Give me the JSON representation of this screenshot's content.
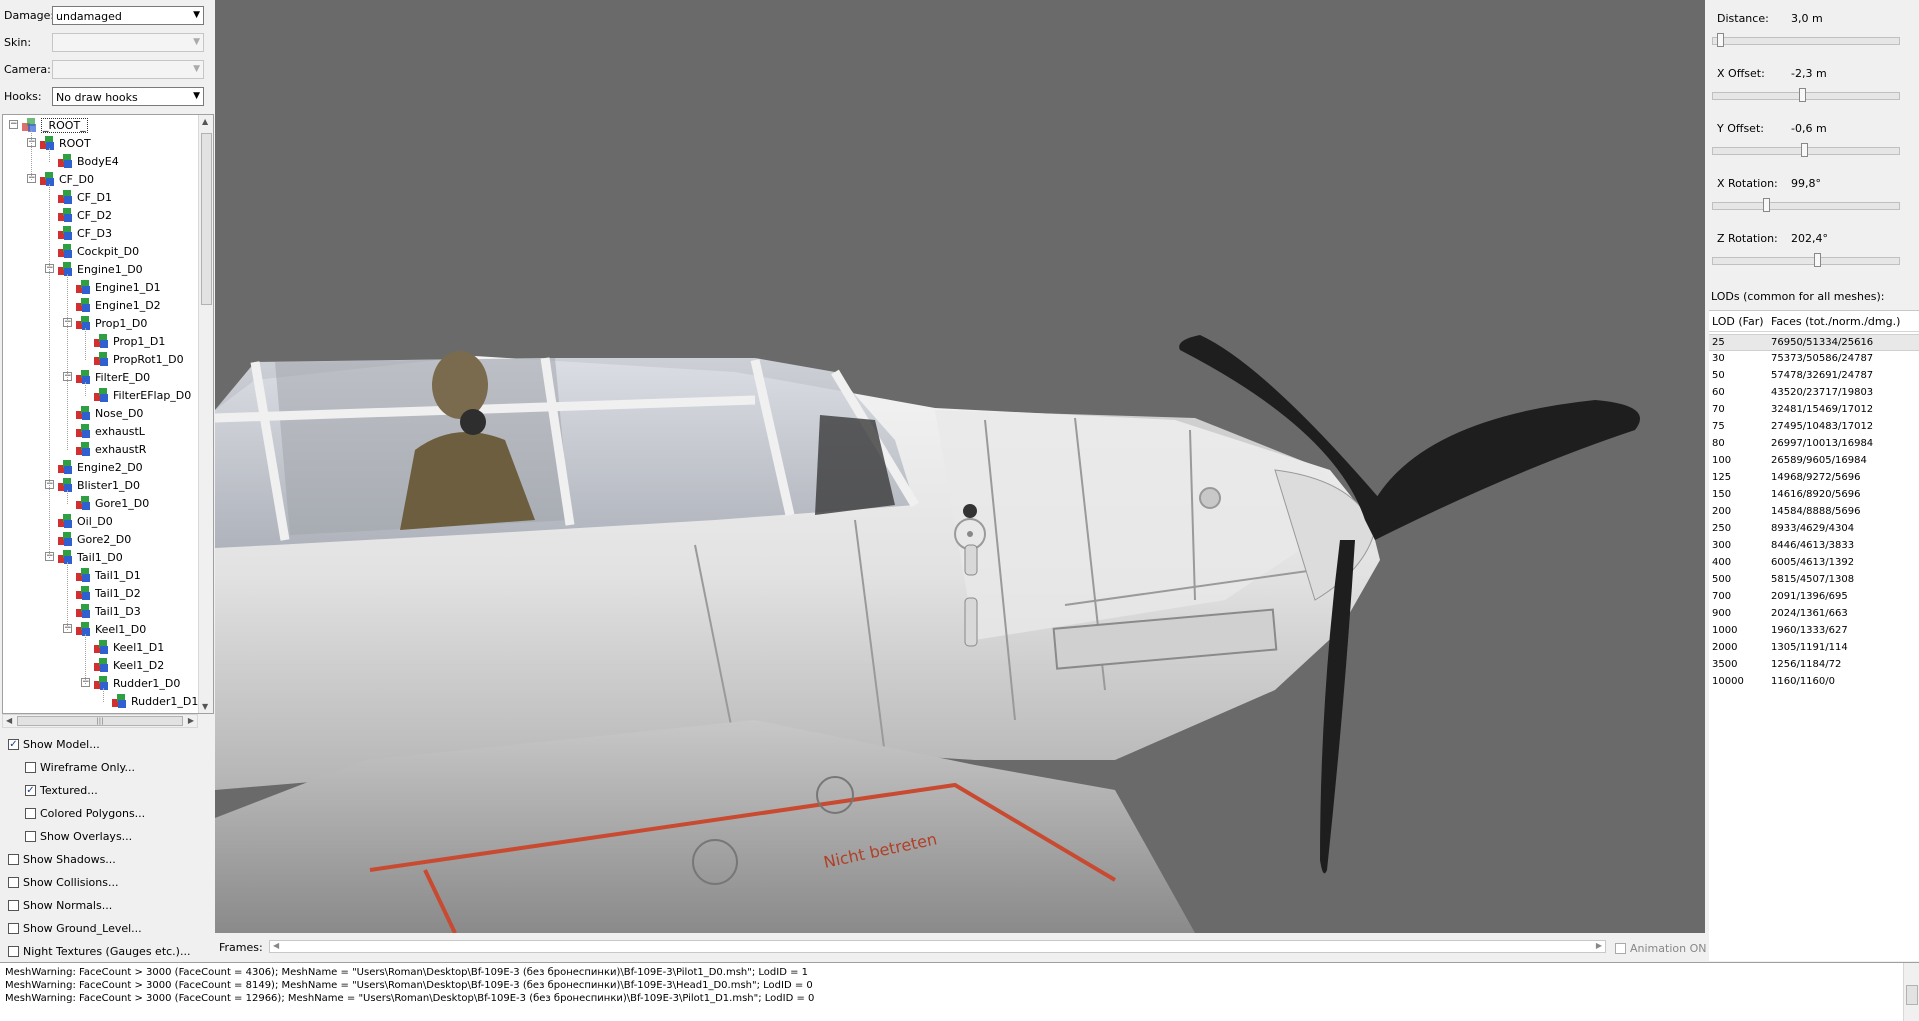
{
  "controls": {
    "damage": {
      "label": "Damage:",
      "value": "undamaged"
    },
    "skin": {
      "label": "Skin:",
      "value": ""
    },
    "camera": {
      "label": "Camera:",
      "value": ""
    },
    "hooks": {
      "label": "Hooks:",
      "value": "No draw hooks"
    }
  },
  "tree": {
    "nodes": [
      {
        "label": "_ROOT_",
        "depth": 0,
        "expandable": true,
        "root": true,
        "selected": true
      },
      {
        "label": "ROOT",
        "depth": 1,
        "expandable": true
      },
      {
        "label": "BodyE4",
        "depth": 2,
        "expandable": false
      },
      {
        "label": "CF_D0",
        "depth": 1,
        "expandable": true
      },
      {
        "label": "CF_D1",
        "depth": 2,
        "expandable": false
      },
      {
        "label": "CF_D2",
        "depth": 2,
        "expandable": false
      },
      {
        "label": "CF_D3",
        "depth": 2,
        "expandable": false
      },
      {
        "label": "Cockpit_D0",
        "depth": 2,
        "expandable": false
      },
      {
        "label": "Engine1_D0",
        "depth": 2,
        "expandable": true
      },
      {
        "label": "Engine1_D1",
        "depth": 3,
        "expandable": false
      },
      {
        "label": "Engine1_D2",
        "depth": 3,
        "expandable": false
      },
      {
        "label": "Prop1_D0",
        "depth": 3,
        "expandable": true
      },
      {
        "label": "Prop1_D1",
        "depth": 4,
        "expandable": false
      },
      {
        "label": "PropRot1_D0",
        "depth": 4,
        "expandable": false
      },
      {
        "label": "FilterE_D0",
        "depth": 3,
        "expandable": true
      },
      {
        "label": "FilterEFlap_D0",
        "depth": 4,
        "expandable": false
      },
      {
        "label": "Nose_D0",
        "depth": 3,
        "expandable": false
      },
      {
        "label": "exhaustL",
        "depth": 3,
        "expandable": false
      },
      {
        "label": "exhaustR",
        "depth": 3,
        "expandable": false
      },
      {
        "label": "Engine2_D0",
        "depth": 2,
        "expandable": false
      },
      {
        "label": "Blister1_D0",
        "depth": 2,
        "expandable": true
      },
      {
        "label": "Gore1_D0",
        "depth": 3,
        "expandable": false
      },
      {
        "label": "Oil_D0",
        "depth": 2,
        "expandable": false
      },
      {
        "label": "Gore2_D0",
        "depth": 2,
        "expandable": false
      },
      {
        "label": "Tail1_D0",
        "depth": 2,
        "expandable": true
      },
      {
        "label": "Tail1_D1",
        "depth": 3,
        "expandable": false
      },
      {
        "label": "Tail1_D2",
        "depth": 3,
        "expandable": false
      },
      {
        "label": "Tail1_D3",
        "depth": 3,
        "expandable": false
      },
      {
        "label": "Keel1_D0",
        "depth": 3,
        "expandable": true
      },
      {
        "label": "Keel1_D1",
        "depth": 4,
        "expandable": false
      },
      {
        "label": "Keel1_D2",
        "depth": 4,
        "expandable": false
      },
      {
        "label": "Rudder1_D0",
        "depth": 4,
        "expandable": true
      },
      {
        "label": "Rudder1_D1",
        "depth": 5,
        "expandable": false
      }
    ]
  },
  "options": [
    {
      "label": "Show Model...",
      "checked": true,
      "indent": 0
    },
    {
      "label": "Wireframe Only...",
      "checked": false,
      "indent": 1
    },
    {
      "label": "Textured...",
      "checked": true,
      "indent": 1
    },
    {
      "label": "Colored Polygons...",
      "checked": false,
      "indent": 1
    },
    {
      "label": "Show Overlays...",
      "checked": false,
      "indent": 1
    },
    {
      "label": "Show Shadows...",
      "checked": false,
      "indent": 0
    },
    {
      "label": "Show Collisions...",
      "checked": false,
      "indent": 0
    },
    {
      "label": "Show Normals...",
      "checked": false,
      "indent": 0
    },
    {
      "label": "Show Ground_Level...",
      "checked": false,
      "indent": 0
    },
    {
      "label": "Night Textures (Gauges etc.)...",
      "checked": false,
      "indent": 0
    }
  ],
  "frames": {
    "label": "Frames:",
    "animation_label": "Animation ON",
    "animation_checked": false
  },
  "camera_params": [
    {
      "label": "Distance:",
      "value": "3,0 m",
      "slider": 0.02
    },
    {
      "label": "X Offset:",
      "value": "-2,3 m",
      "slider": 0.48
    },
    {
      "label": "Y Offset:",
      "value": "-0,6 m",
      "slider": 0.49
    },
    {
      "label": "X Rotation:",
      "value": "99,8°",
      "slider": 0.28
    },
    {
      "label": "Z Rotation:",
      "value": "202,4°",
      "slider": 0.56
    }
  ],
  "lod": {
    "caption": "LODs (common for all meshes):",
    "headers": [
      "LOD (Far)",
      "Faces (tot./norm./dmg.)"
    ],
    "rows": [
      [
        "25",
        "76950/51334/25616"
      ],
      [
        "30",
        "75373/50586/24787"
      ],
      [
        "50",
        "57478/32691/24787"
      ],
      [
        "60",
        "43520/23717/19803"
      ],
      [
        "70",
        "32481/15469/17012"
      ],
      [
        "75",
        "27495/10483/17012"
      ],
      [
        "80",
        "26997/10013/16984"
      ],
      [
        "100",
        "26589/9605/16984"
      ],
      [
        "125",
        "14968/9272/5696"
      ],
      [
        "150",
        "14616/8920/5696"
      ],
      [
        "200",
        "14584/8888/5696"
      ],
      [
        "250",
        "8933/4629/4304"
      ],
      [
        "300",
        "8446/4613/3833"
      ],
      [
        "400",
        "6005/4613/1392"
      ],
      [
        "500",
        "5815/4507/1308"
      ],
      [
        "700",
        "2091/1396/695"
      ],
      [
        "900",
        "2024/1361/663"
      ],
      [
        "1000",
        "1960/1333/627"
      ],
      [
        "2000",
        "1305/1191/114"
      ],
      [
        "3500",
        "1256/1184/72"
      ],
      [
        "10000",
        "1160/1160/0"
      ]
    ],
    "selected_index": 0
  },
  "log": [
    "MeshWarning: FaceCount > 3000 (FaceCount = 4306); MeshName = \"Users\\Roman\\Desktop\\Bf-109E-3 (без бронеспинки)\\Bf-109E-3\\Pilot1_D0.msh\"; LodID = 1",
    "MeshWarning: FaceCount > 3000 (FaceCount = 8149); MeshName = \"Users\\Roman\\Desktop\\Bf-109E-3 (без бронеспинки)\\Bf-109E-3\\Head1_D0.msh\"; LodID = 0",
    "MeshWarning: FaceCount > 3000 (FaceCount = 12966); MeshName = \"Users\\Roman\\Desktop\\Bf-109E-3 (без бронеспинки)\\Bf-109E-3\\Pilot1_D1.msh\"; LodID = 0"
  ],
  "viewport": {
    "background_color": "#6a6a6a",
    "wing_text": "Nicht betreten"
  }
}
